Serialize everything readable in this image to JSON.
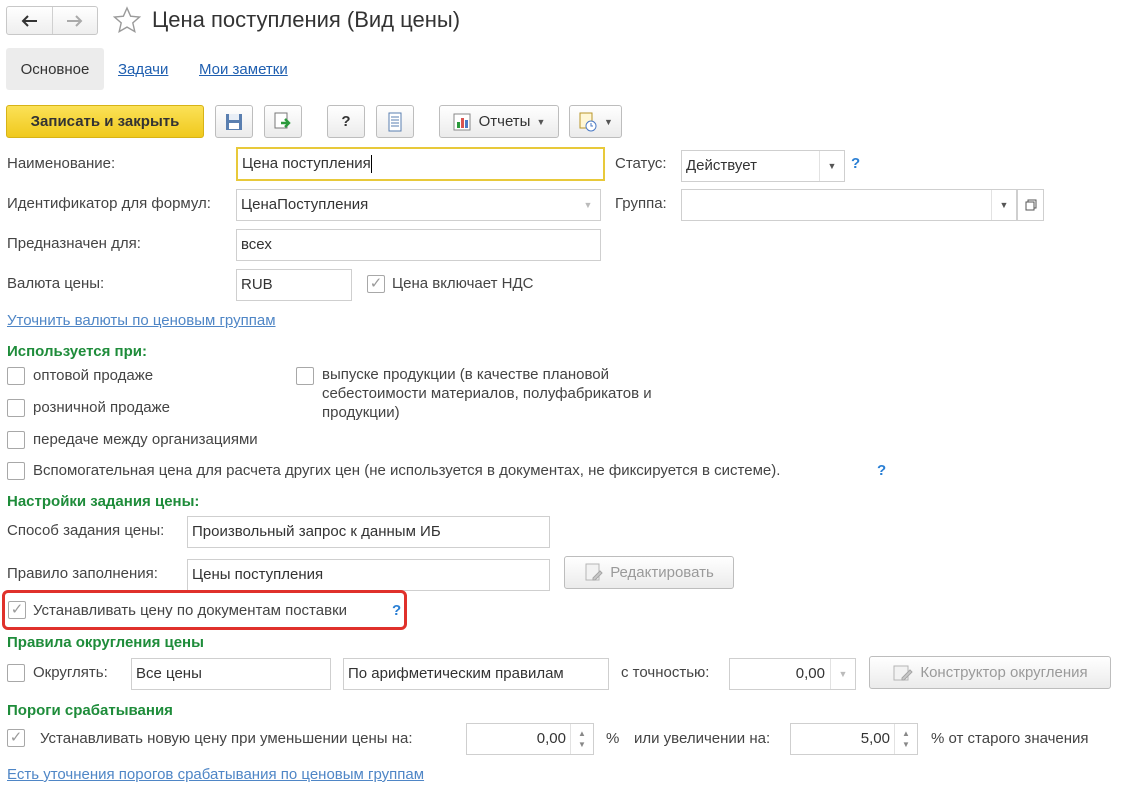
{
  "window": {
    "title": "Цена поступления (Вид цены)"
  },
  "tabs": [
    {
      "label": "Основное"
    },
    {
      "label": "Задачи"
    },
    {
      "label": "Мои заметки"
    }
  ],
  "toolbar": {
    "save_close_label": "Записать и закрыть",
    "help_label": "?",
    "reports_label": "Отчеты"
  },
  "form": {
    "name_label": "Наименование:",
    "name_value": "Цена поступления",
    "status_label": "Статус:",
    "status_value": "Действует",
    "formula_id_label": "Идентификатор для формул:",
    "formula_id_value": "ЦенаПоступления",
    "group_label": "Группа:",
    "group_value": "",
    "intended_label": "Предназначен для:",
    "intended_value": "всех",
    "currency_label": "Валюта цены:",
    "currency_value": "RUB",
    "vat_label": "Цена включает НДС",
    "vat_checked": true,
    "refine_currency_link": "Уточнить валюты по ценовым группам"
  },
  "usage": {
    "title": "Используется при:",
    "wholesale": "оптовой продаже",
    "retail": "розничной продаже",
    "transfer": "передаче между организациями",
    "production_line1": "выпуске продукции (в качестве плановой",
    "production_line2": "себестоимости материалов, полуфабрикатов и",
    "production_line3": "продукции)",
    "auxiliary": "Вспомогательная цена для расчета других цен (не используется в документах, не фиксируется в системе).",
    "help": "?"
  },
  "price_settings": {
    "title": "Настройки задания цены:",
    "method_label": "Способ задания цены:",
    "method_value": "Произвольный запрос к данным ИБ",
    "rule_label": "Правило заполнения:",
    "rule_value": "Цены поступления",
    "edit_button": "Редактировать",
    "set_by_docs_label": "Устанавливать цену по документам поставки",
    "set_by_docs_checked": true,
    "help": "?",
    "highlight_color": "#e0312b"
  },
  "rounding": {
    "title": "Правила округления цены",
    "round_label": "Округлять:",
    "scope_value": "Все цены",
    "method_value": "По арифметическим правилам",
    "precision_label": "с точностью:",
    "precision_value": "0,00",
    "constructor_button": "Конструктор округления"
  },
  "thresholds": {
    "title": "Пороги срабатывания",
    "set_new_label": "Устанавливать новую цену при уменьшении цены на:",
    "decrease_value": "0,00",
    "percent_sign": "%",
    "increase_label": "или увеличении на:",
    "increase_value": "5,00",
    "from_old_label": "% от старого значения",
    "refine_link": "Есть уточнения порогов срабатывания по ценовым группам"
  },
  "colors": {
    "primary_button": "#f5d22a",
    "section_green": "#1e8c3a",
    "link_blue": "#4f86c6",
    "focus_border": "#e8c93a"
  }
}
